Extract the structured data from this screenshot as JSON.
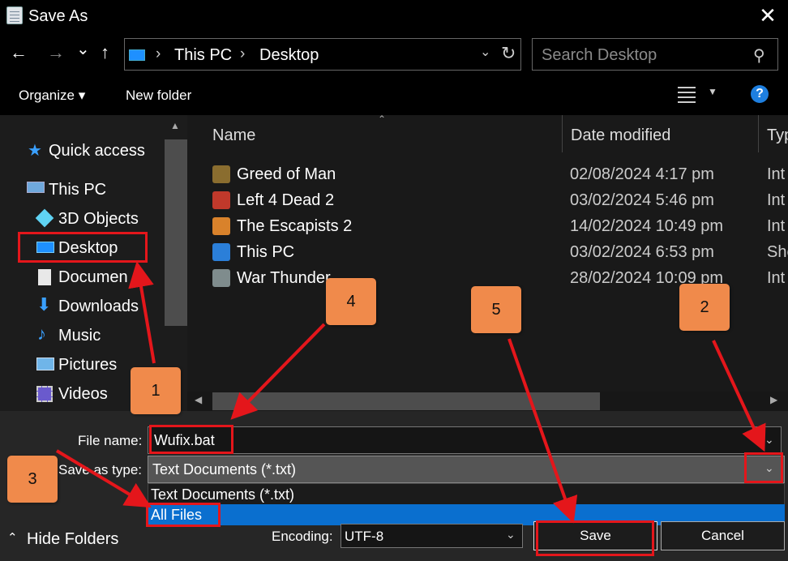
{
  "window": {
    "title": "Save As"
  },
  "nav": {
    "back": "←",
    "forward": "→",
    "recent": "⌄",
    "up": "↑",
    "breadcrumb": [
      "This PC",
      "Desktop"
    ],
    "search_placeholder": "Search Desktop"
  },
  "toolbar": {
    "organize": "Organize ▾",
    "new_folder": "New folder",
    "help": "?"
  },
  "sidebar": {
    "items": [
      {
        "label": "Quick access",
        "icon": "star-icon"
      },
      {
        "label": "This PC",
        "icon": "computer-icon"
      },
      {
        "label": "3D Objects",
        "icon": "cube-icon"
      },
      {
        "label": "Desktop",
        "icon": "desktop-icon"
      },
      {
        "label": "Documen",
        "icon": "document-icon"
      },
      {
        "label": "Downloads",
        "icon": "download-icon"
      },
      {
        "label": "Music",
        "icon": "music-icon"
      },
      {
        "label": "Pictures",
        "icon": "pictures-icon"
      },
      {
        "label": "Videos",
        "icon": "videos-icon"
      }
    ]
  },
  "files": {
    "columns": [
      "Name",
      "Date modified",
      "Typ"
    ],
    "rows": [
      {
        "name": "Greed of Man",
        "date": "02/08/2024 4:17 pm",
        "type": "Int",
        "color": "#8a6d2f"
      },
      {
        "name": "Left 4 Dead 2",
        "date": "03/02/2024 5:46 pm",
        "type": "Int",
        "color": "#c0392b"
      },
      {
        "name": "The Escapists 2",
        "date": "14/02/2024 10:49 pm",
        "type": "Int",
        "color": "#d9822b"
      },
      {
        "name": "This PC",
        "date": "03/02/2024 6:53 pm",
        "type": "She",
        "color": "#2b7fd9"
      },
      {
        "name": "War Thunder",
        "date": "28/02/2024 10:09 pm",
        "type": "Int",
        "color": "#7f8c8d"
      }
    ]
  },
  "form": {
    "file_name_label": "File name:",
    "file_name_value": "Wufix.bat",
    "save_type_label": "Save as type:",
    "save_type_value": "Text Documents (*.txt)",
    "type_options": [
      "Text Documents (*.txt)",
      "All Files"
    ],
    "encoding_label": "Encoding:",
    "encoding_value": "UTF-8",
    "save_button": "Save",
    "cancel_button": "Cancel",
    "hide_folders": "Hide Folders"
  },
  "callouts": [
    "1",
    "2",
    "3",
    "4",
    "5"
  ],
  "colors": {
    "highlight": "#0a6fcf",
    "annotation_red": "#e4161b",
    "callout_orange": "#f08a4b"
  }
}
